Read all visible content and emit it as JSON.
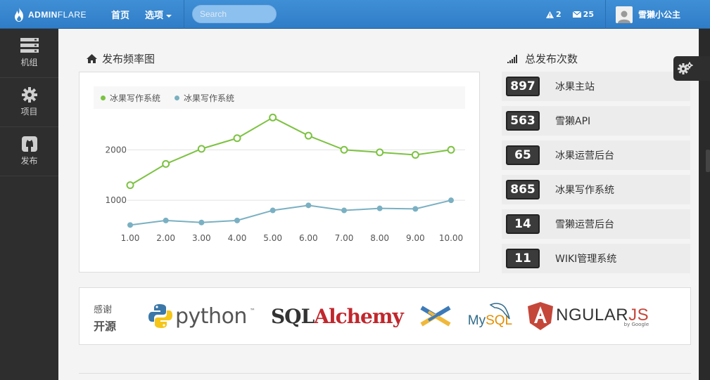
{
  "brand": {
    "bold": "ADMIN",
    "rest": "FLARE"
  },
  "topnav": [
    {
      "label": "首页"
    },
    {
      "label": "选项"
    }
  ],
  "search": {
    "placeholder": "Search"
  },
  "alerts": {
    "count": "2"
  },
  "messages": {
    "count": "25"
  },
  "user": {
    "name": "雪獭小公主"
  },
  "sidebar": {
    "items": [
      {
        "label": "机组"
      },
      {
        "label": "项目"
      },
      {
        "label": "发布"
      }
    ]
  },
  "chart_section": {
    "title": "发布频率图"
  },
  "stats_section": {
    "title": "总发布次数"
  },
  "stats": [
    {
      "num": "897",
      "label": "冰果主站"
    },
    {
      "num": "563",
      "label": "雪獭API"
    },
    {
      "num": "65",
      "label": "冰果运营后台"
    },
    {
      "num": "865",
      "label": "冰果写作系统"
    },
    {
      "num": "14",
      "label": "雪獭运营后台"
    },
    {
      "num": "11",
      "label": "WIKI管理系统"
    }
  ],
  "thanks": {
    "line1": "感谢",
    "line2": "开源"
  },
  "logos": {
    "python": "python",
    "python_tm": "™",
    "sqlalchemy_a": "SQL",
    "sqlalchemy_b": "Alchemy",
    "mysql_a": "My",
    "mysql_b": "SQL",
    "angular_a": "A",
    "angular_b": "NGULAR",
    "angular_c": "JS",
    "angular_sub": "by Google"
  },
  "colors": {
    "series1": "#7dc242",
    "series2": "#7ab0c2",
    "topbar": "#3586d0"
  },
  "chart_data": {
    "type": "line",
    "x": [
      1,
      2,
      3,
      4,
      5,
      6,
      7,
      8,
      9,
      10
    ],
    "xticks": [
      "1.00",
      "2.00",
      "3.00",
      "4.00",
      "5.00",
      "6.00",
      "7.00",
      "8.00",
      "9.00",
      "10.00"
    ],
    "yticks": [
      1000,
      2000
    ],
    "ylim": [
      0,
      2700
    ],
    "legend_position": "top-left",
    "series": [
      {
        "name": "冰果写作系统",
        "values": [
          1300,
          1720,
          2020,
          2230,
          2640,
          2280,
          2000,
          1950,
          1900,
          2000
        ]
      },
      {
        "name": "冰果写作系统",
        "values": [
          510,
          600,
          560,
          600,
          800,
          900,
          800,
          840,
          830,
          1000
        ]
      }
    ]
  }
}
